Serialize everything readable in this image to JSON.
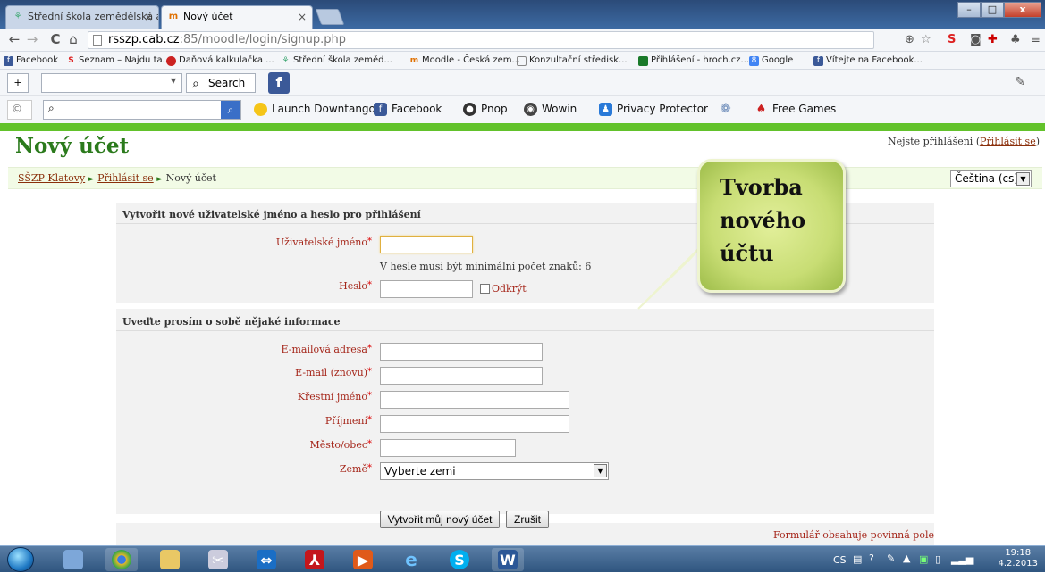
{
  "tabs": [
    {
      "title": "Střední škola zemědělská a",
      "active": false
    },
    {
      "title": "Nový účet",
      "active": true
    }
  ],
  "address": {
    "host": "rsszp.cab.cz",
    "path": ":85/moodle/login/signup.php"
  },
  "bookmarks": [
    "Facebook",
    "Seznam – Najdu ta...",
    "Daňová kalkulačka ...",
    "Střední škola zeměd...",
    "Moodle - Česká zem...",
    "Konzultační středisk...",
    "Přihlášení - hroch.cz...",
    "Google",
    "Vítejte na Facebook..."
  ],
  "toolbar1": {
    "search_label": "Search",
    "add_label": "+"
  },
  "toolbar2": {
    "items": [
      "Launch Downtango",
      "Facebook",
      "Pnop",
      "Wowin",
      "Privacy Protector",
      "Free Games"
    ]
  },
  "page": {
    "title": "Nový účet",
    "login_prefix": "Nejste přihlášeni (",
    "login_link": "Přihlásit se",
    "login_suffix": ")",
    "breadcrumb": {
      "home": "SŠZP Klatovy",
      "login": "Přihlásit se",
      "current": "Nový účet",
      "sep": "►"
    },
    "language": "Čeština (cs)"
  },
  "form": {
    "section1": "Vytvořit nové uživatelské jméno a heslo pro přihlášení",
    "username_label": "Uživatelské jméno",
    "password_note": "V hesle musí být minimální počet znaků: 6",
    "password_label": "Heslo",
    "reveal_label": "Odkrýt",
    "section2": "Uveďte prosím o sobě nějaké informace",
    "email_label": "E-mailová adresa",
    "email2_label": "E-mail (znovu)",
    "firstname_label": "Křestní jméno",
    "lastname_label": "Příjmení",
    "city_label": "Město/obec",
    "country_label": "Země",
    "country_value": "Vyberte zemi",
    "required_mark": "*",
    "submit_label": "Vytvořit můj nový účet",
    "cancel_label": "Zrušit",
    "required_note": "Formulář obsahuje povinná pole"
  },
  "callout": {
    "lines": [
      "Tvorba",
      "nového",
      "účtu"
    ]
  },
  "taskbar": {
    "lang": "CS",
    "time": "19:18",
    "date": "4.2.2013"
  },
  "colors": {
    "green": "#62c22b",
    "title_green": "#2b7a1c",
    "label_red": "#a5261a",
    "callout": "#c8dd74"
  }
}
